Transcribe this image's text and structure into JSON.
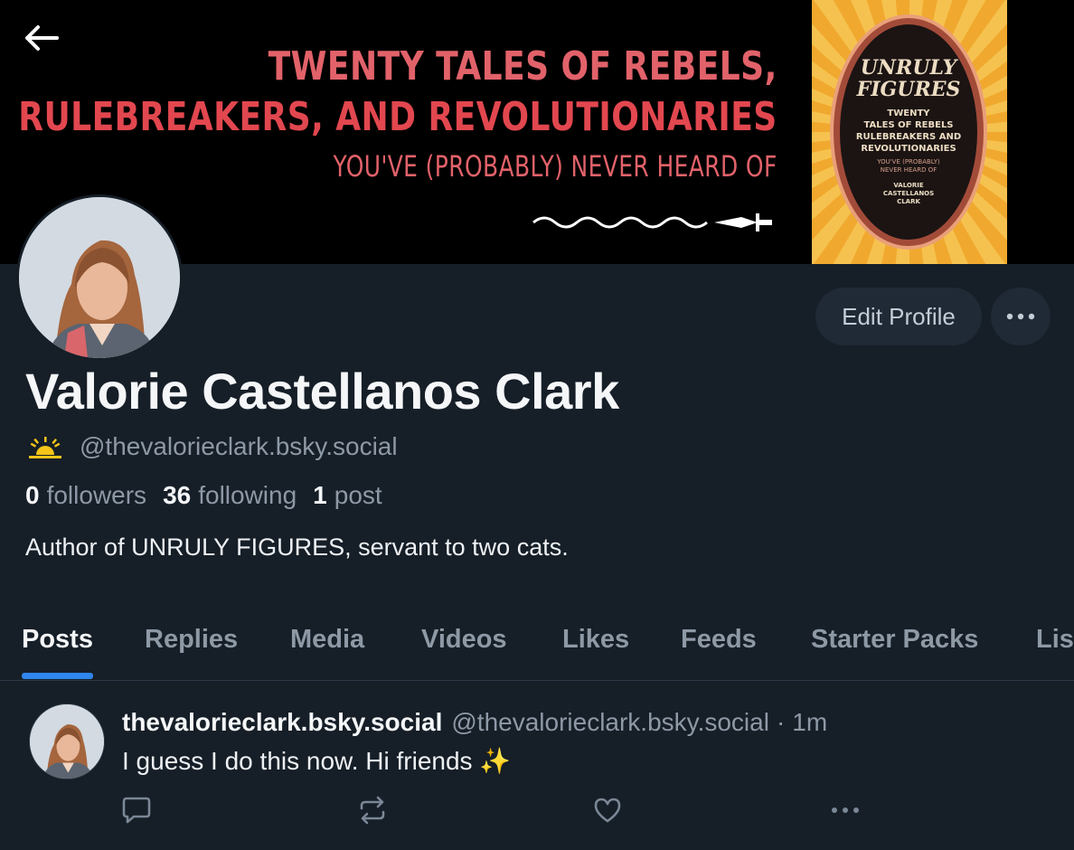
{
  "banner": {
    "line1": "TWENTY TALES OF REBELS,",
    "line2": "RULEBREAKERS, AND REVOLUTIONARIES",
    "line3": "YOU'VE (PROBABLY) NEVER HEARD OF",
    "book": {
      "title_line1": "UNRULY",
      "title_line2": "FIGURES",
      "subtitle_line1": "TWENTY",
      "subtitle_line2": "TALES OF REBELS",
      "subtitle_line3": "RULEBREAKERS AND",
      "subtitle_line4": "REVOLUTIONARIES",
      "tagline_line1": "YOU'VE (PROBABLY)",
      "tagline_line2": "NEVER HEARD OF",
      "author_line1": "VALORIE",
      "author_line2": "CASTELLANOS",
      "author_line3": "CLARK"
    }
  },
  "profile": {
    "display_name": "Valorie Castellanos Clark",
    "handle": "@thevalorieclark.bsky.social",
    "followers_count": "0",
    "followers_label": "followers",
    "following_count": "36",
    "following_label": "following",
    "posts_count": "1",
    "posts_label": "post",
    "bio": "Author of UNRULY FIGURES, servant to two cats.",
    "edit_label": "Edit Profile"
  },
  "tabs": [
    {
      "label": "Posts"
    },
    {
      "label": "Replies"
    },
    {
      "label": "Media"
    },
    {
      "label": "Videos"
    },
    {
      "label": "Likes"
    },
    {
      "label": "Feeds"
    },
    {
      "label": "Starter Packs"
    },
    {
      "label": "Lis"
    }
  ],
  "post": {
    "author": "thevalorieclark.bsky.social",
    "handle": "@thevalorieclark.bsky.social",
    "separator": "·",
    "time": "1m",
    "text": "I guess I do this now. Hi friends ✨"
  },
  "colors": {
    "background": "#161e27",
    "accent": "#2f86ec",
    "muted_text": "#8e99a6"
  }
}
